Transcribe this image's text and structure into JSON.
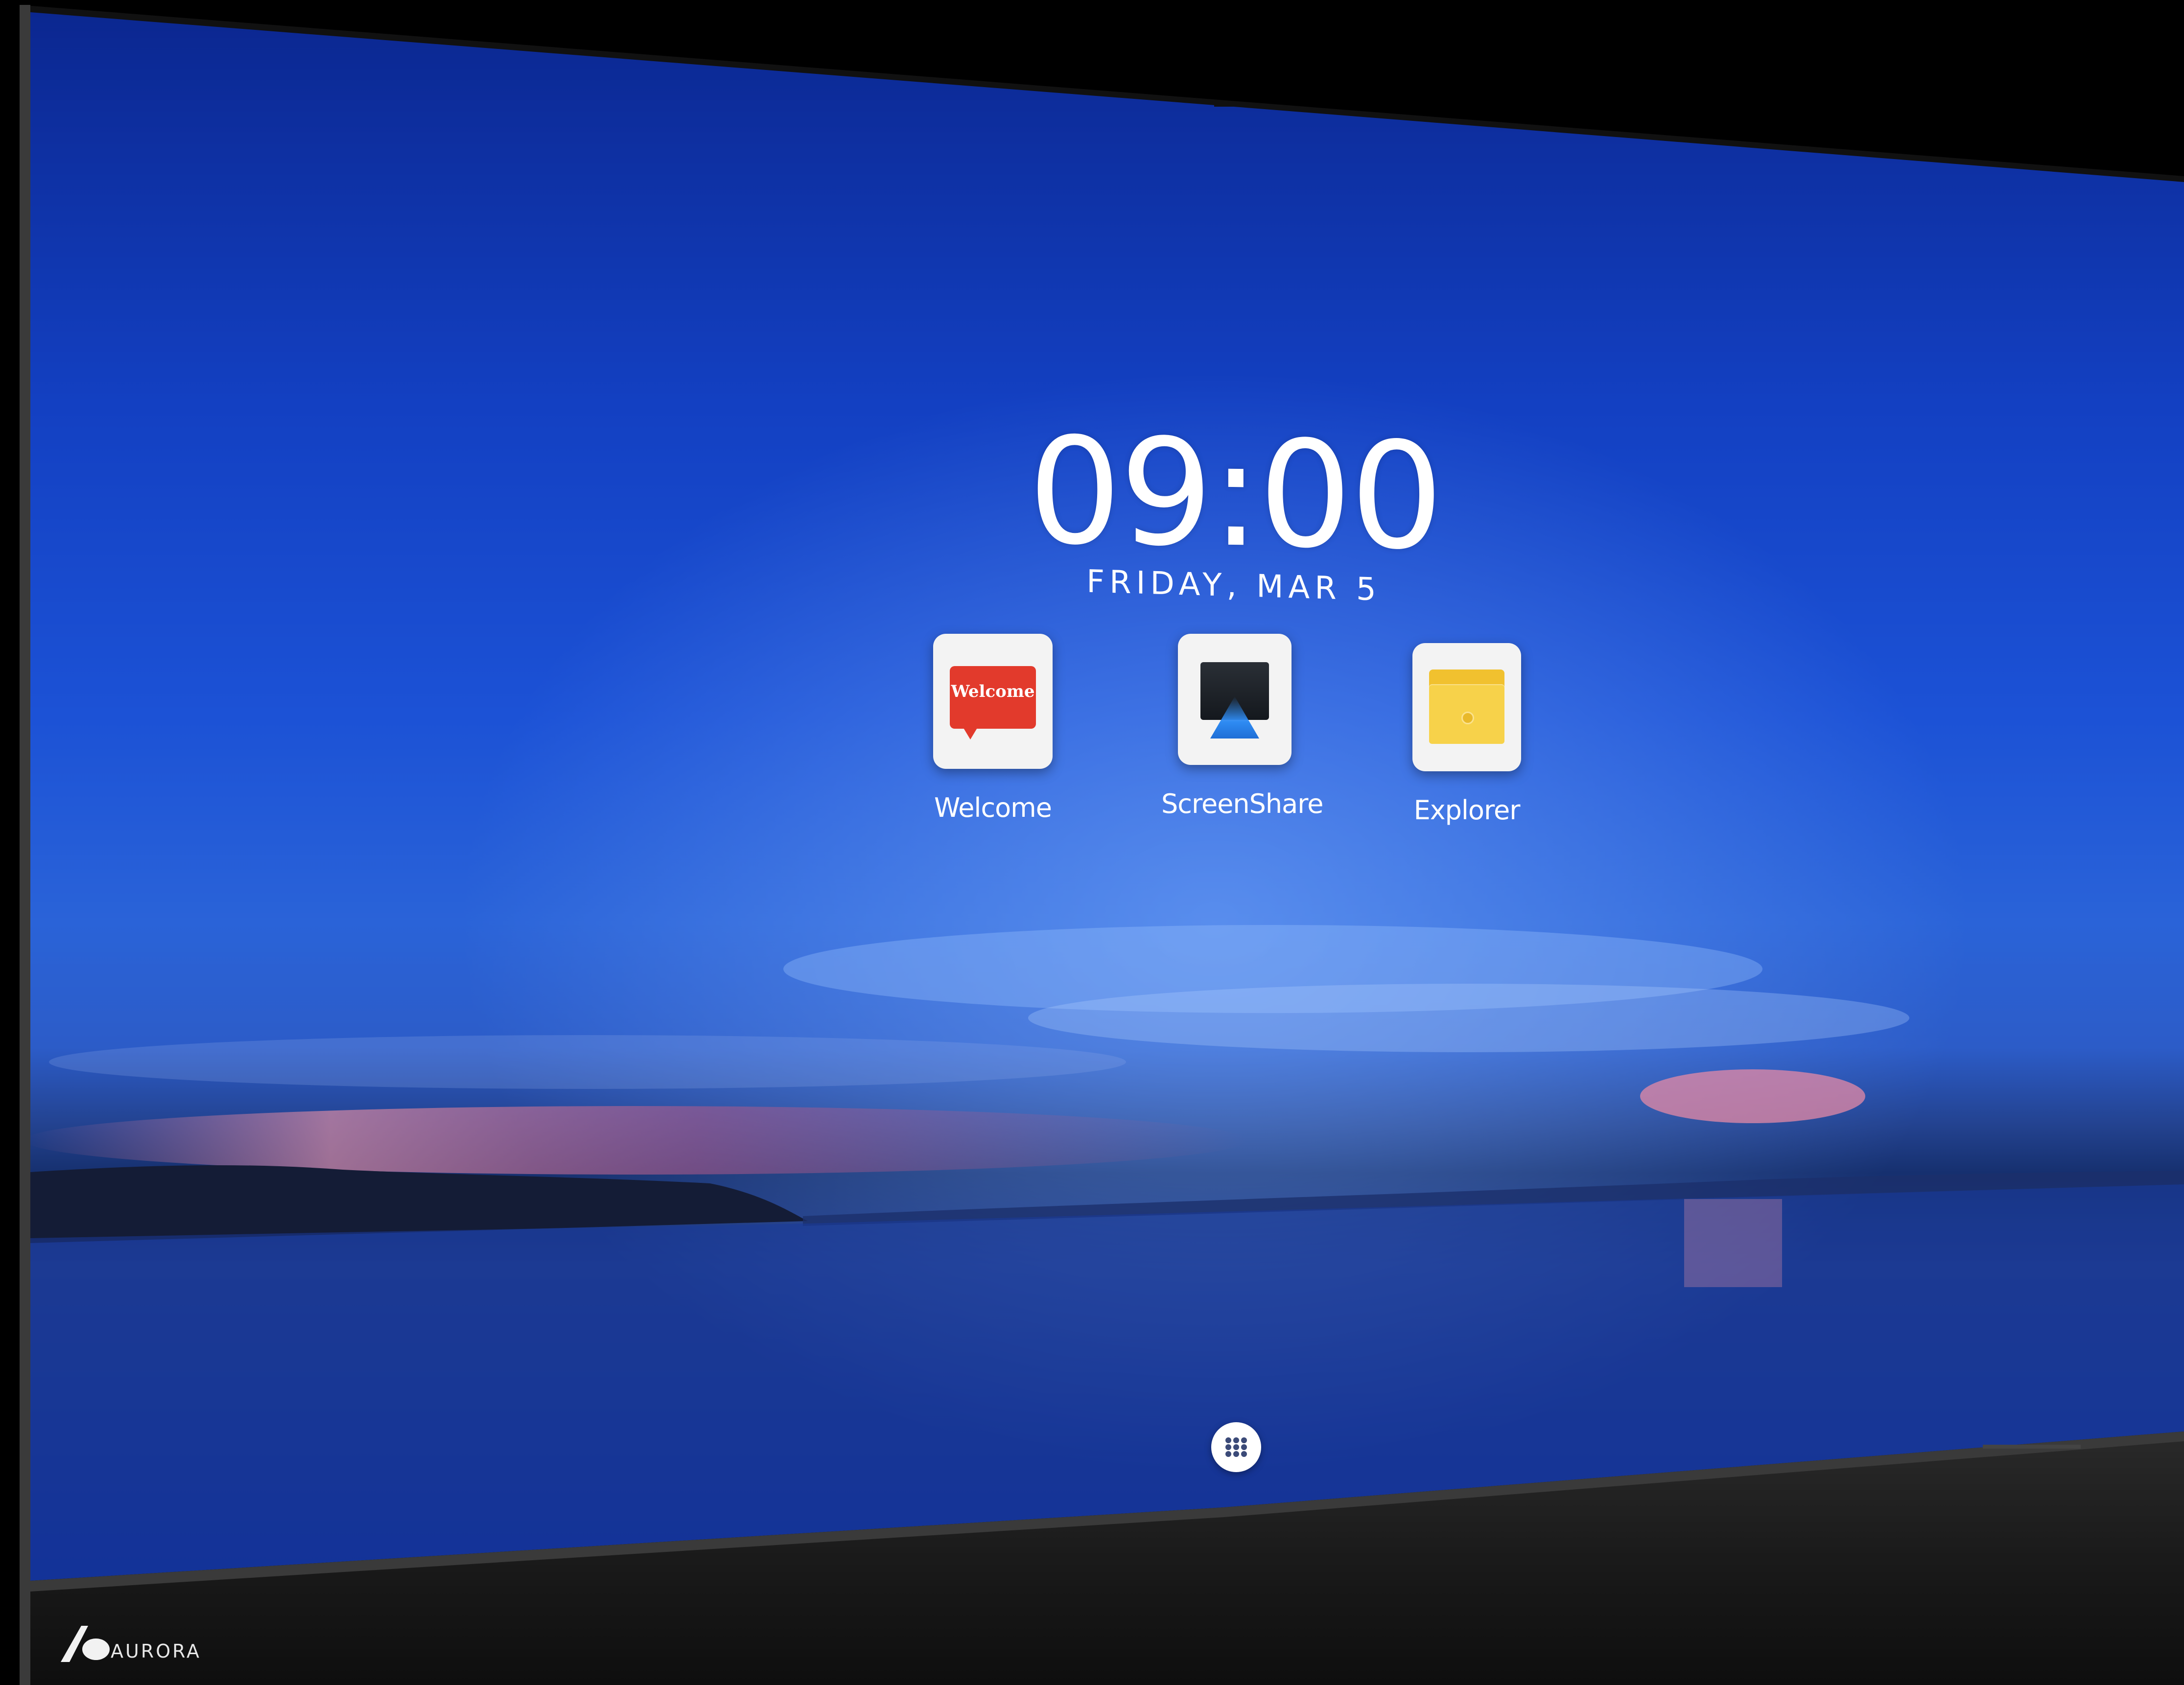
{
  "home_screen": {
    "time": "09:00",
    "date": "FRIDAY, MAR 5"
  },
  "apps": [
    {
      "label": "Welcome",
      "icon": "welcome-speech-bubble-icon",
      "icon_text": "Welcome"
    },
    {
      "label": "ScreenShare",
      "icon": "screenshare-monitor-icon"
    },
    {
      "label": "Explorer",
      "icon": "folder-icon"
    }
  ],
  "dock": {
    "apps_drawer_icon": "grid-dots-icon"
  },
  "device": {
    "brand": "AURORA",
    "logo_icon": "aurora-logo-icon"
  },
  "colors": {
    "sky_top": "#0d2a9a",
    "sky_mid": "#1e4fd0",
    "horizon_pink": "#e07a9b",
    "bezel": "#1a1a1a",
    "welcome_red": "#e23a2c",
    "explorer_yellow": "#f7d24a",
    "screenshare_blue": "#2f8cf3"
  }
}
